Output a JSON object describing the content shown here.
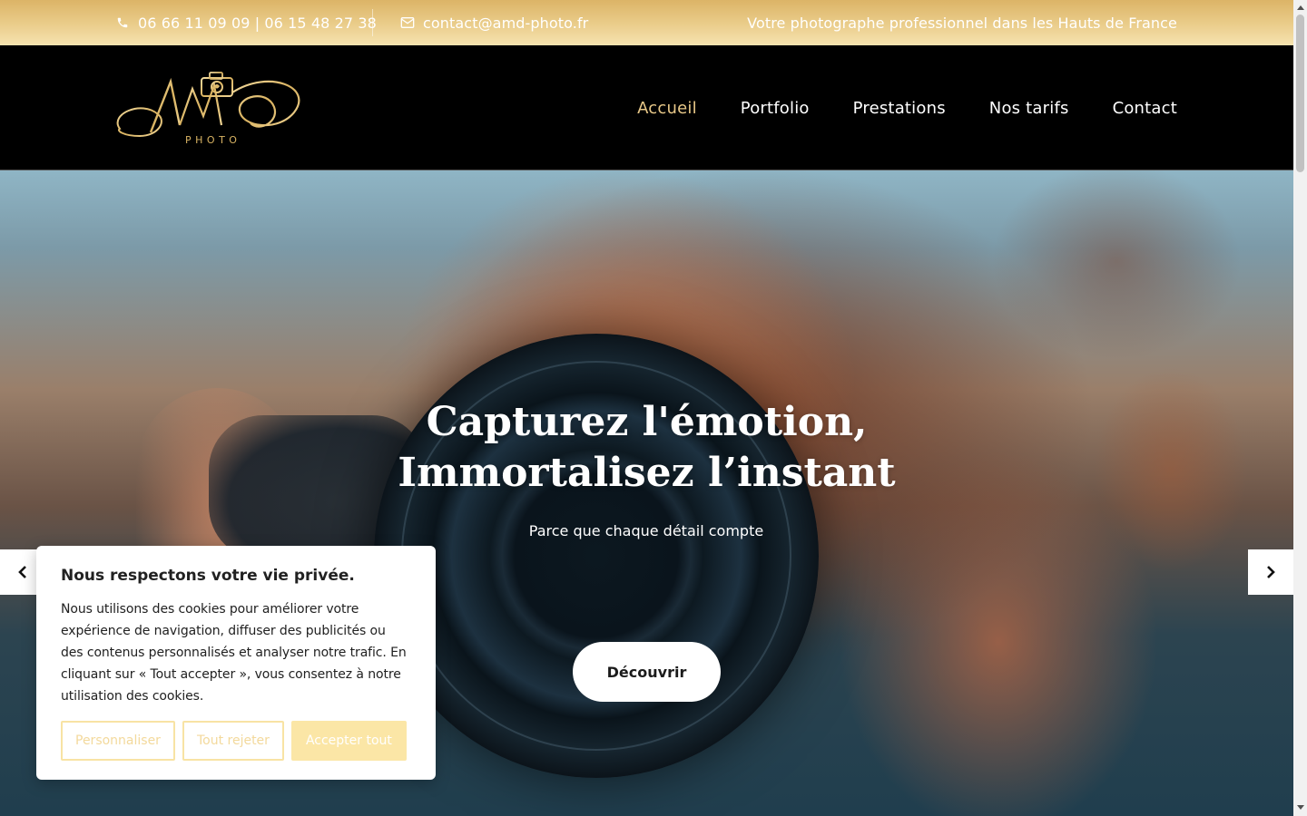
{
  "topbar": {
    "phone": "06 66 11 09 09 | 06 15 48 27 38",
    "email": "contact@amd-photo.fr",
    "slogan": "Votre photographe professionnel dans les Hauts de France",
    "phone_icon": "phone-icon",
    "email_icon": "envelope-icon"
  },
  "header": {
    "logo_text": "AMD",
    "logo_subtext": "PHOTO",
    "nav": [
      {
        "label": "Accueil",
        "active": true
      },
      {
        "label": "Portfolio",
        "active": false
      },
      {
        "label": "Prestations",
        "active": false
      },
      {
        "label": "Nos tarifs",
        "active": false
      },
      {
        "label": "Contact",
        "active": false
      }
    ]
  },
  "hero": {
    "title": "Capturez l'émotion, Immortalisez l’instant",
    "subtitle": "Parce que chaque détail compte",
    "button_label": "Découvrir",
    "prev_icon": "chevron-left-icon",
    "next_icon": "chevron-right-icon"
  },
  "cookie": {
    "title": "Nous respectons votre vie privée.",
    "text": "Nous utilisons des cookies pour améliorer votre expérience de navigation, diffuser des publicités ou des contenus personnalisés et analyser notre trafic. En cliquant sur « Tout accepter », vous consentez à notre utilisation des cookies.",
    "customize_label": "Personnaliser",
    "reject_label": "Tout rejeter",
    "accept_label": "Accepter tout"
  },
  "colors": {
    "gold": "#e8c888",
    "topbar_start": "#dcb467",
    "topbar_end": "#f6e3b0",
    "header_bg": "#000000",
    "cookie_accent": "#fbe6a6"
  }
}
